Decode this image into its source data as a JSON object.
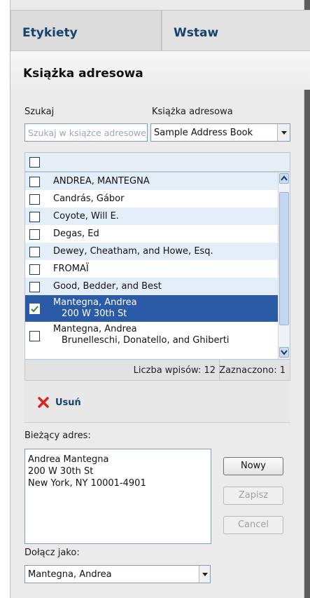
{
  "tabs": [
    {
      "label": "Etykiety"
    },
    {
      "label": "Wstaw"
    }
  ],
  "panel_title": "Książka adresowa",
  "search": {
    "label": "Szukaj",
    "placeholder": "Szukaj w książce adresowej"
  },
  "address_book": {
    "label": "Książka adresowa",
    "selected": "Sample Address Book"
  },
  "list": {
    "items": [
      {
        "name": "ANDREA, MANTEGNA",
        "sub": "",
        "checked": false
      },
      {
        "name": "Candrás, Gábor",
        "sub": "",
        "checked": false
      },
      {
        "name": "Coyote, Will E.",
        "sub": "",
        "checked": false
      },
      {
        "name": "Degas, Ed",
        "sub": "",
        "checked": false
      },
      {
        "name": "Dewey, Cheatham, and Howe, Esq.",
        "sub": "",
        "checked": false
      },
      {
        "name": "FROMAÏ",
        "sub": "",
        "checked": false
      },
      {
        "name": "Good, Bedder, and Best",
        "sub": "",
        "checked": false
      },
      {
        "name": "Mantegna, Andrea",
        "sub": "200 W 30th St",
        "checked": true
      },
      {
        "name": "Mantegna, Andrea",
        "sub": "Brunelleschi, Donatello, and Ghiberti",
        "checked": false
      }
    ]
  },
  "status": {
    "count": "Liczba wpisów: 12",
    "selected": "Zaznaczono: 1"
  },
  "delete_label": "Usuń",
  "current_address": {
    "label": "Bieżący adres:",
    "text": "Andrea Mantegna\n200 W 30th St\nNew York, NY 10001-4901"
  },
  "buttons": {
    "new": "Nowy",
    "save": "Zapisz",
    "cancel": "Cancel"
  },
  "attach_as": {
    "label": "Dołącz jako:",
    "selected": "Mantegna, Andrea"
  },
  "colors": {
    "selection": "#2b5aa6",
    "link": "#15436d",
    "delete_icon": "#d9261c"
  }
}
